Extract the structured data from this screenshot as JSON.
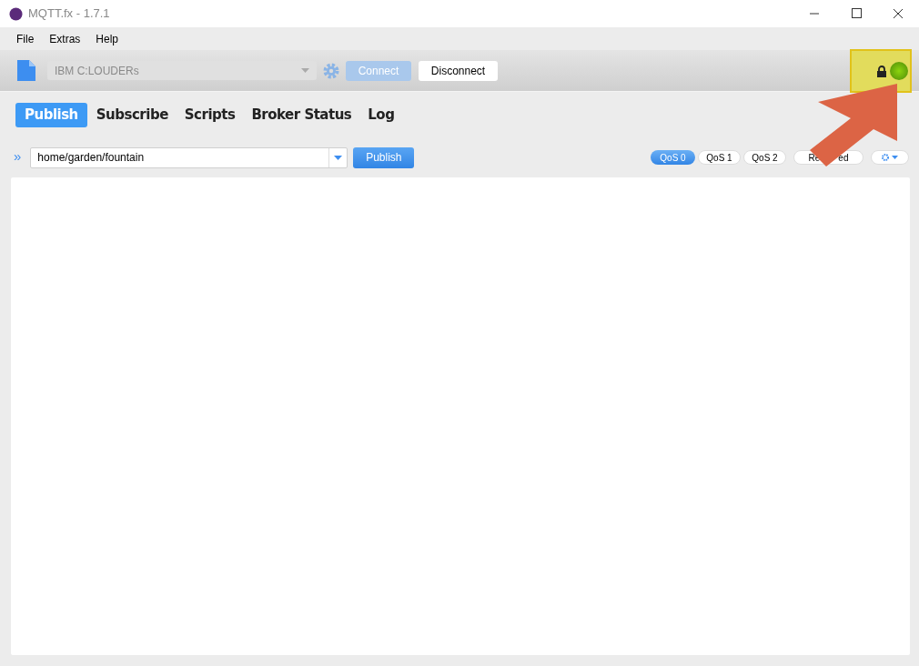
{
  "window": {
    "title": "MQTT.fx - 1.7.1"
  },
  "menu": [
    "File",
    "Extras",
    "Help"
  ],
  "toolbar": {
    "profile": "IBM C:LOUDERs",
    "connect": "Connect",
    "disconnect": "Disconnect",
    "connected": true
  },
  "tabs": [
    {
      "label": "Publish",
      "selected": true
    },
    {
      "label": "Subscribe",
      "selected": false
    },
    {
      "label": "Scripts",
      "selected": false
    },
    {
      "label": "Broker Status",
      "selected": false
    },
    {
      "label": "Log",
      "selected": false
    }
  ],
  "publish": {
    "expand": "»",
    "topic": "home/garden/fountain",
    "button": "Publish",
    "qos": [
      {
        "label": "QoS 0",
        "selected": true
      },
      {
        "label": "QoS 1",
        "selected": false
      },
      {
        "label": "QoS 2",
        "selected": false
      }
    ],
    "retained": {
      "label_visible_parts": [
        "Re",
        "ed"
      ],
      "selected": false
    }
  },
  "annotation": {
    "highlight": true
  }
}
